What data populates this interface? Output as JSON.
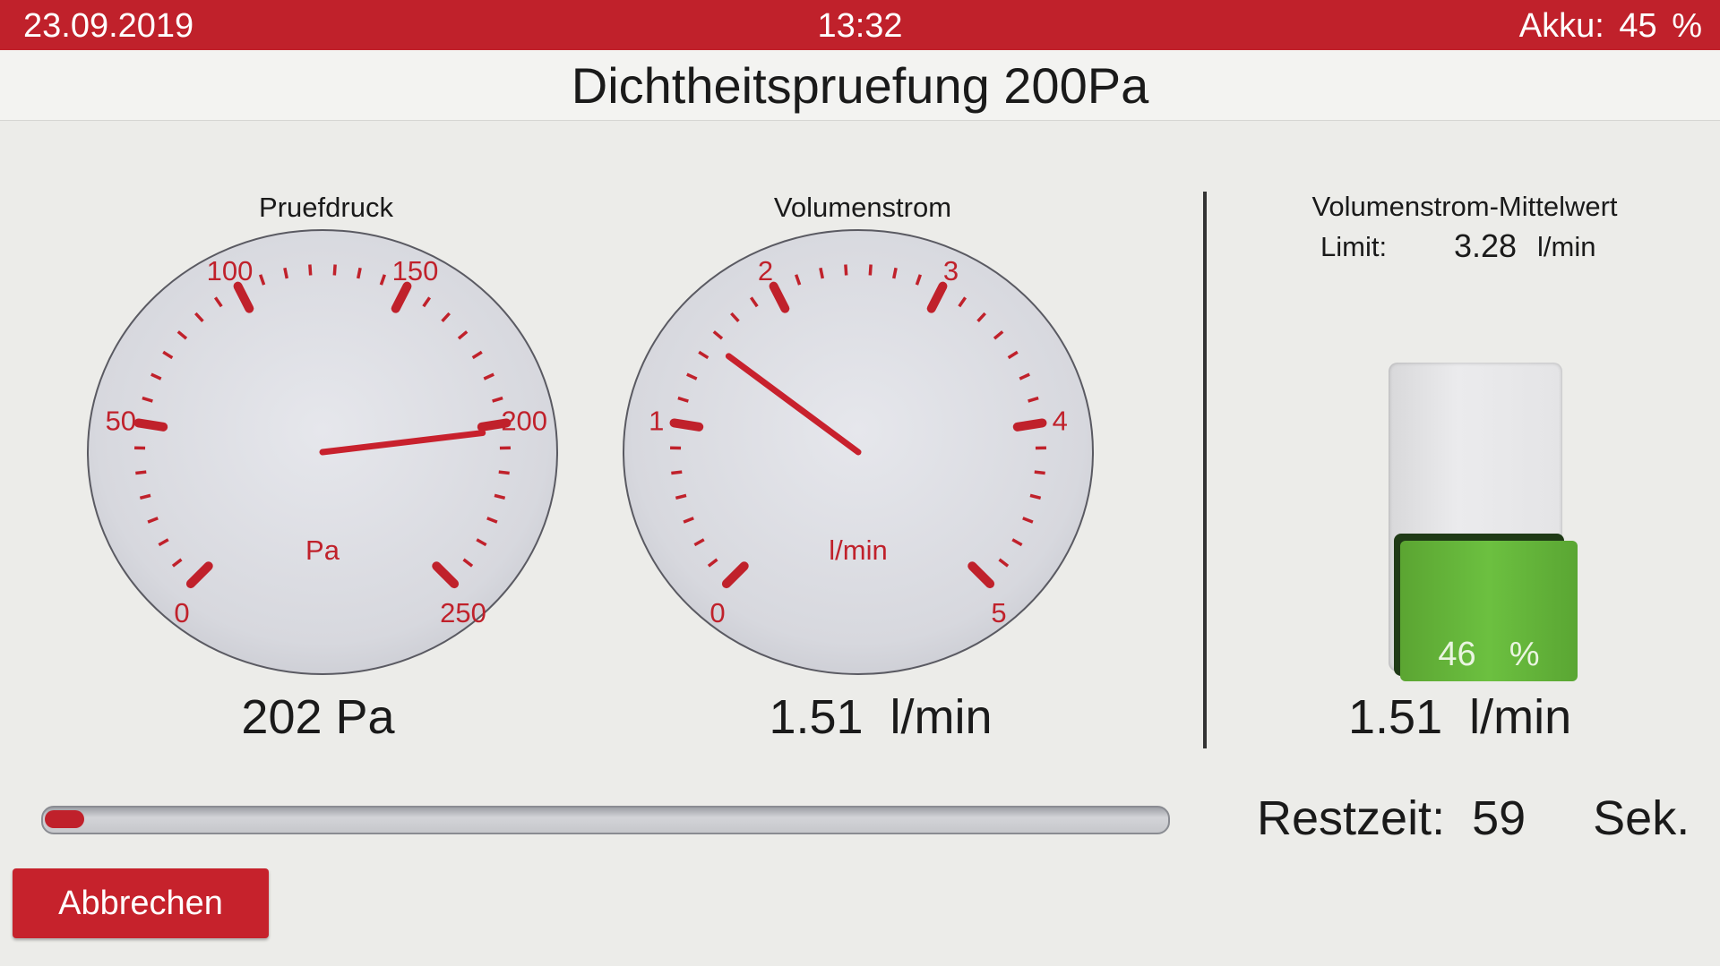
{
  "status_bar": {
    "date": "23.09.2019",
    "time": "13:32",
    "akku": "Akku:  45   %"
  },
  "title": "Dichtheitspruefung 200Pa",
  "gauges": [
    {
      "label": "Pruefdruck",
      "unit": "Pa",
      "min": 0,
      "max": 250,
      "major_ticks": [
        "0",
        "50",
        "100",
        "150",
        "200",
        "250"
      ],
      "needle_value": 202,
      "readout": "202 Pa"
    },
    {
      "label": "Volumenstrom",
      "unit": "l/min",
      "min": 0,
      "max": 5,
      "major_ticks": [
        "0",
        "1",
        "2",
        "3",
        "4",
        "5"
      ],
      "needle_value": 1.51,
      "readout": "1.51  l/min"
    }
  ],
  "mittelwert": {
    "title": "Volumenstrom-Mittelwert",
    "limit_label": "Limit:",
    "limit_value": "3.28",
    "limit_unit": "l/min",
    "bar_percent": 46,
    "bar_label": "46  %",
    "value": "1.51  l/min"
  },
  "progress": {
    "fraction": 0.02
  },
  "restzeit": {
    "label": "Restzeit:  59     Sek."
  },
  "buttons": {
    "cancel": "Abbrechen"
  },
  "colors": {
    "accent": "#c0212b",
    "bar_green": "#6cc040",
    "gauge_face": "#dcdde3"
  }
}
